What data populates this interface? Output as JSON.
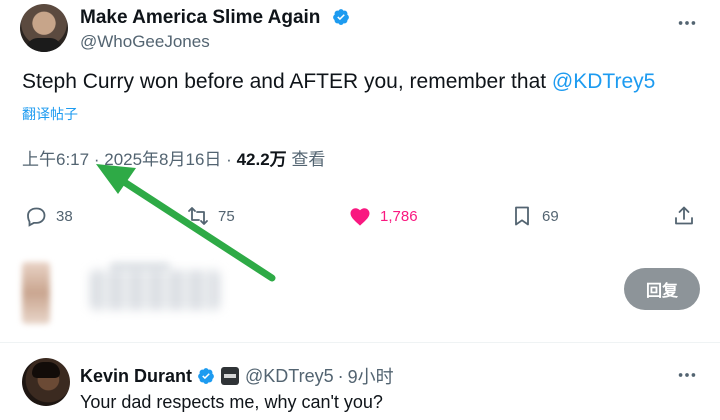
{
  "tweet": {
    "author_name": "Make America Slime Again",
    "author_handle": "@WhoGeeJones",
    "text_main": "Steph Curry won before and AFTER you, remember that ",
    "text_mention": "@KDTrey5",
    "translate_label": "翻译帖子",
    "time": "上午6:17",
    "date": "2025年8月16日",
    "separator": "·",
    "views_count": "42.2万",
    "views_label": "查看",
    "more_icon": "more-horizontal-icon"
  },
  "actions": {
    "reply_count": "38",
    "retweet_count": "75",
    "like_count": "1,786",
    "bookmark_count": "69"
  },
  "composer": {
    "reply_button_label": "回复"
  },
  "reply": {
    "author_name": "Kevin Durant",
    "author_handle": "@KDTrey5",
    "separator": "·",
    "time_ago": "9小时",
    "text": "Your dad respects me, why can't you?"
  },
  "colors": {
    "accent": "#1d9bf0",
    "like": "#f91880",
    "secondary_text": "#536471",
    "arrow": "#2eaa46"
  }
}
